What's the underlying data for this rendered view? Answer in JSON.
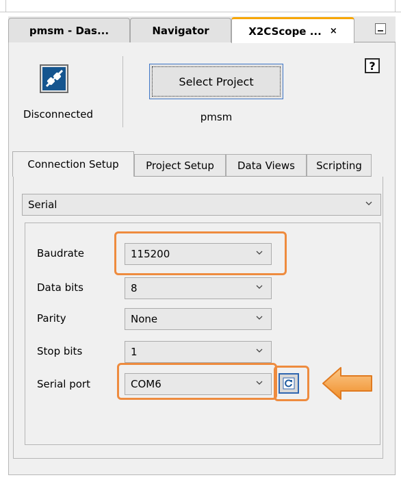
{
  "tabs": [
    {
      "label": "pmsm - Das...",
      "active": false
    },
    {
      "label": "Navigator",
      "active": false
    },
    {
      "label": "X2CScope ...",
      "active": true,
      "close": "×"
    }
  ],
  "toolbar": {
    "connection_status": "Disconnected",
    "connection_icon": "plug-disconnected-icon",
    "select_project_label": "Select Project",
    "project_name": "pmsm",
    "help_label": "?"
  },
  "inner_tabs": [
    "Connection Setup",
    "Project Setup",
    "Data Views",
    "Scripting"
  ],
  "connection": {
    "type": "Serial",
    "fields": [
      {
        "label": "Baudrate",
        "value": "115200"
      },
      {
        "label": "Data bits",
        "value": "8"
      },
      {
        "label": "Parity",
        "value": "None"
      },
      {
        "label": "Stop bits",
        "value": "1"
      },
      {
        "label": "Serial port",
        "value": "COM6"
      }
    ],
    "refresh_icon": "refresh-icon"
  },
  "colors": {
    "accent_tab": "#f7a600",
    "highlight": "#ee8b3e",
    "arrow": "#f5a343",
    "icon_blue": "#15558f"
  }
}
